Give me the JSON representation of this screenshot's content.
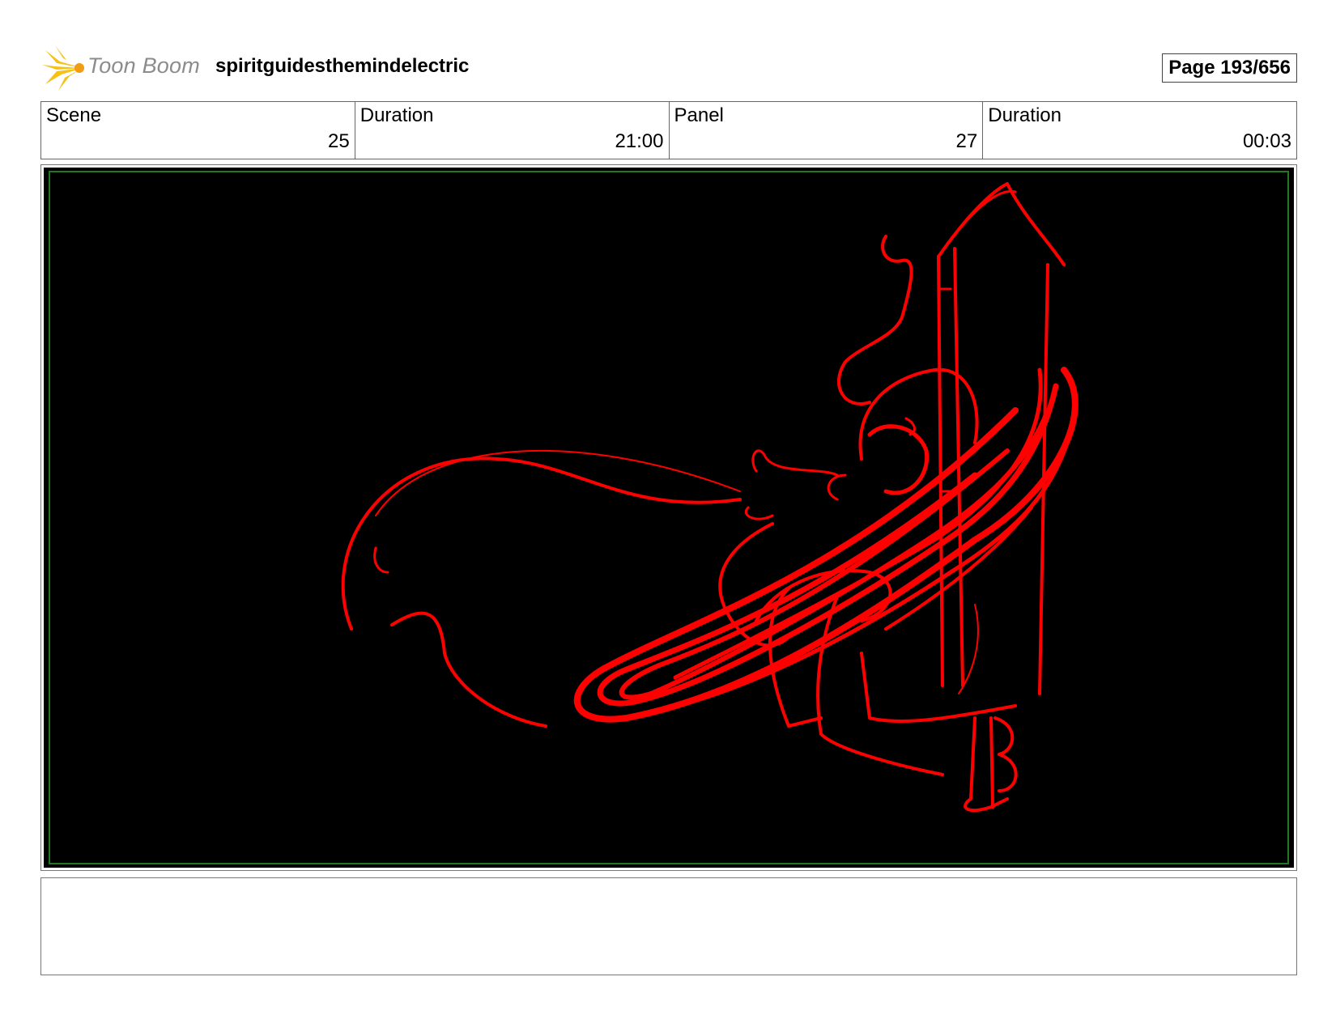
{
  "header": {
    "brand": "Toon Boom",
    "title": "spiritguidesthemindelectric",
    "page": "Page 193/656"
  },
  "info": {
    "scene_label": "Scene",
    "scene_value": "25",
    "scene_duration_label": "Duration",
    "scene_duration_value": "21:00",
    "panel_label": "Panel",
    "panel_value": "27",
    "panel_duration_label": "Duration",
    "panel_duration_value": "00:03"
  },
  "panel": {
    "background_color": "#000000",
    "safe_frame_color": "#1f7a1f",
    "sketch_color": "#ff0000"
  },
  "notes": {
    "text": ""
  }
}
